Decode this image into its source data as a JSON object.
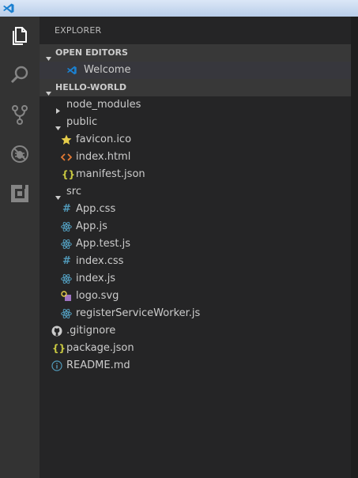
{
  "explorer": {
    "title": "EXPLORER"
  },
  "open_editors": {
    "header": "OPEN EDITORS",
    "items": [
      {
        "label": "Welcome",
        "icon": "vscode-icon"
      }
    ]
  },
  "workspace": {
    "header": "HELLO-WORLD",
    "tree": [
      {
        "label": "node_modules",
        "type": "folder",
        "expanded": false
      },
      {
        "label": "public",
        "type": "folder",
        "expanded": true
      },
      {
        "label": "favicon.ico",
        "icon": "star-icon"
      },
      {
        "label": "index.html",
        "icon": "html-icon"
      },
      {
        "label": "manifest.json",
        "icon": "json-icon"
      },
      {
        "label": "src",
        "type": "folder",
        "expanded": true
      },
      {
        "label": "App.css",
        "icon": "css-hash-icon"
      },
      {
        "label": "App.js",
        "icon": "react-icon"
      },
      {
        "label": "App.test.js",
        "icon": "react-icon"
      },
      {
        "label": "index.css",
        "icon": "css-hash-icon"
      },
      {
        "label": "index.js",
        "icon": "react-icon"
      },
      {
        "label": "logo.svg",
        "icon": "svg-icon"
      },
      {
        "label": "registerServiceWorker.js",
        "icon": "react-icon"
      },
      {
        "label": ".gitignore",
        "icon": "github-icon"
      },
      {
        "label": "package.json",
        "icon": "json-icon"
      },
      {
        "label": "README.md",
        "icon": "info-icon"
      }
    ]
  },
  "colors": {
    "activity_bar": "#333333",
    "sidebar": "#252526",
    "section_header": "#383838",
    "selected_row": "#37373d",
    "react_icon": "#519aba",
    "json_icon": "#cbcb41",
    "html_icon": "#e37933",
    "svg_icon": "#a074c4",
    "vscode_blue": "#1b80d0"
  }
}
